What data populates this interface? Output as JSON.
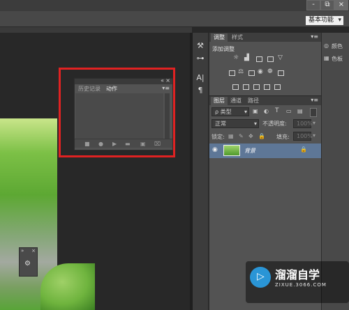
{
  "window": {
    "min_label": "-",
    "restore_label": "⧉",
    "close_label": "×"
  },
  "workspace": {
    "selected": "基本功能"
  },
  "actions_panel": {
    "tabs": [
      {
        "label": "历史记录",
        "active": false
      },
      {
        "label": "动作",
        "active": true
      }
    ],
    "footer_icons": [
      "stop-icon",
      "record-icon",
      "play-icon",
      "folder-icon",
      "new-action-icon",
      "delete-icon"
    ]
  },
  "adjustments_panel": {
    "tabs": [
      {
        "label": "调整",
        "active": true
      },
      {
        "label": "样式",
        "active": false
      }
    ],
    "title": "添加调整"
  },
  "layers_panel": {
    "tabs": [
      {
        "label": "图层",
        "active": true
      },
      {
        "label": "通道",
        "active": false
      },
      {
        "label": "路径",
        "active": false
      }
    ],
    "filter_type": "ρ 类型",
    "blend_mode": "正常",
    "opacity_label": "不透明度:",
    "opacity_value": "100%",
    "lock_label": "锁定:",
    "fill_label": "填充:",
    "fill_value": "100%",
    "layers": [
      {
        "name": "背景",
        "visible": true,
        "locked": true
      }
    ]
  },
  "right_panel": {
    "items": [
      "颜色",
      "色板"
    ]
  },
  "watermark": {
    "title": "溜溜自学",
    "url": "ZIXUE.3066.COM"
  }
}
